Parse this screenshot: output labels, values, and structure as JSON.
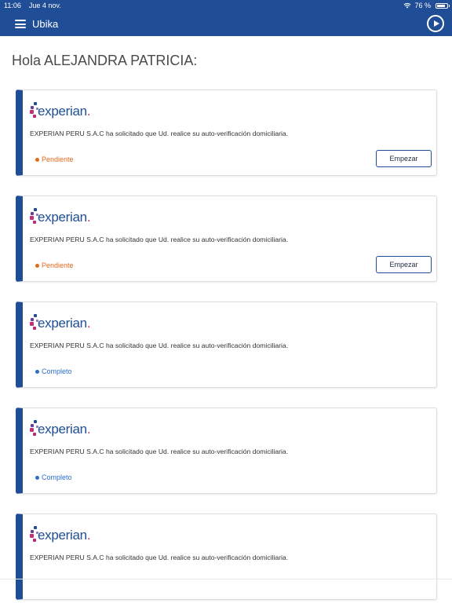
{
  "status_bar": {
    "time": "11:06",
    "date": "Jue 4 nov.",
    "battery": "76 %"
  },
  "nav": {
    "title": "Ubika",
    "menu_icon": "hamburger-menu-icon",
    "play_icon": "play-circle-icon"
  },
  "greeting": "Hola ALEJANDRA PATRICIA:",
  "colors": {
    "brand": "#1f4e96",
    "pending": "#e06a1b",
    "complete": "#2a6fc9",
    "logo_accent": "#c0317a"
  },
  "cards": [
    {
      "logo_word": "experian",
      "logo_period": ".",
      "description": "EXPERIAN PERU S.A.C ha solicitado que Ud. realice su auto-verificación domiciliaria.",
      "status": "Pendiente",
      "status_type": "pending",
      "button": "Empezar"
    },
    {
      "logo_word": "experian",
      "logo_period": ".",
      "description": "EXPERIAN PERU S.A.C ha solicitado que Ud. realice su auto-verificación domiciliaria.",
      "status": "Pendiente",
      "status_type": "pending",
      "button": "Empezar"
    },
    {
      "logo_word": "experian",
      "logo_period": ".",
      "description": "EXPERIAN PERU S.A.C ha solicitado que Ud. realice su auto-verificación domiciliaria.",
      "status": "Completo",
      "status_type": "complete",
      "button": ""
    },
    {
      "logo_word": "experian",
      "logo_period": ".",
      "description": "EXPERIAN PERU S.A.C ha solicitado que Ud. realice su auto-verificación domiciliaria.",
      "status": "Completo",
      "status_type": "complete",
      "button": ""
    },
    {
      "logo_word": "experian",
      "logo_period": ".",
      "description": "EXPERIAN PERU S.A.C ha solicitado que Ud. realice su auto-verificación domiciliaria.",
      "status": "",
      "status_type": "",
      "button": ""
    }
  ]
}
